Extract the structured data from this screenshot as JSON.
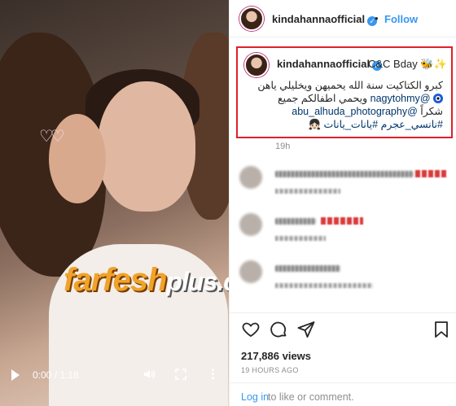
{
  "video": {
    "watermark_main": "farfesh",
    "watermark_plus": "plus.com",
    "time": "0:00 / 1:18",
    "play_icon": "play-icon",
    "volume_icon": "volume-icon",
    "fullscreen_icon": "fullscreen-icon",
    "more_icon": "more-vertical-icon"
  },
  "header": {
    "username": "kindahannaofficial",
    "verified": "✓",
    "separator": "•",
    "follow_label": "Follow"
  },
  "caption": {
    "username": "kindahannaofficial",
    "verified": "✓",
    "title": "C&C Bday 🐝✨",
    "line1": "كبرو الكتاكيت سنة الله يحميهن ويخليلي ياهن",
    "line2_mention": "@nagytohmy",
    "line2_text": " ويحمي اطفالكم جميع ",
    "line3_text": "شكراً ",
    "line3_mention": "@abu_alhuda_photography",
    "line4": "#نانسي_عجرم #يانات_يانات 👧🏻",
    "time_ago": "19h"
  },
  "actions": {
    "like_icon": "heart-icon",
    "comment_icon": "comment-icon",
    "share_icon": "share-icon",
    "save_icon": "bookmark-icon"
  },
  "stats": {
    "views": "217,886 views",
    "posted": "19 HOURS AGO"
  },
  "footer": {
    "login_label": "Log in",
    "rest_text": "to like or comment."
  },
  "colors": {
    "accent": "#3897f0",
    "highlight_border": "#e0202a",
    "watermark": "#f0a32a"
  }
}
